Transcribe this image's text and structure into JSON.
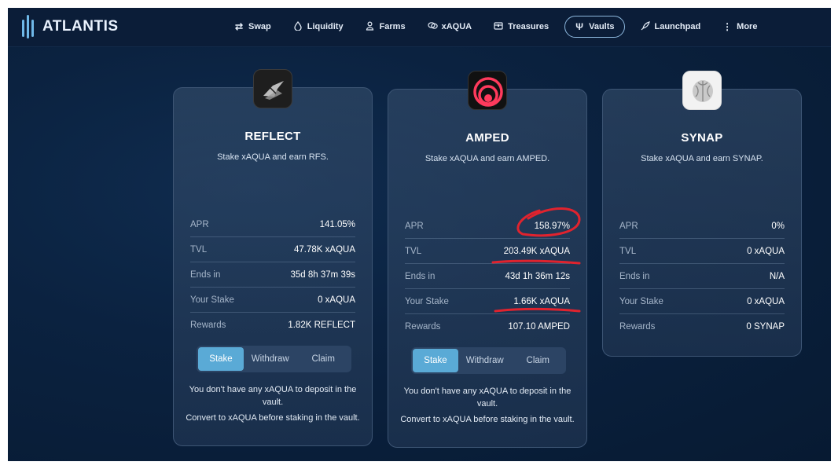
{
  "brand": {
    "name": "ATLANTIS"
  },
  "nav": {
    "items": [
      {
        "label": "Swap",
        "icon": "swap-icon"
      },
      {
        "label": "Liquidity",
        "icon": "droplet-icon"
      },
      {
        "label": "Farms",
        "icon": "farm-icon"
      },
      {
        "label": "xAQUA",
        "icon": "coins-icon"
      },
      {
        "label": "Treasures",
        "icon": "treasure-icon"
      },
      {
        "label": "Vaults",
        "icon": "trident-icon",
        "active": true
      },
      {
        "label": "Launchpad",
        "icon": "rocket-icon"
      },
      {
        "label": "More",
        "icon": "more-icon"
      }
    ]
  },
  "vaults": [
    {
      "title": "REFLECT",
      "description": "Stake xAQUA and earn RFS.",
      "token_icon": "reflect-token-icon",
      "stats": {
        "apr": {
          "label": "APR",
          "value": "141.05%"
        },
        "tvl": {
          "label": "TVL",
          "value": "47.78K xAQUA"
        },
        "ends": {
          "label": "Ends in",
          "value": "35d 8h 37m 39s"
        },
        "stake": {
          "label": "Your Stake",
          "value": "0 xAQUA"
        },
        "rewards": {
          "label": "Rewards",
          "value": "1.82K REFLECT"
        }
      },
      "tabs": [
        "Stake",
        "Withdraw",
        "Claim"
      ],
      "notice": [
        "You don't have any xAQUA to deposit in the vault.",
        "Convert to xAQUA before staking in the vault."
      ]
    },
    {
      "title": "AMPED",
      "description": "Stake xAQUA and earn AMPED.",
      "token_icon": "amped-token-icon",
      "stats": {
        "apr": {
          "label": "APR",
          "value": "158.97%"
        },
        "tvl": {
          "label": "TVL",
          "value": "203.49K xAQUA"
        },
        "ends": {
          "label": "Ends in",
          "value": "43d 1h 36m 12s"
        },
        "stake": {
          "label": "Your Stake",
          "value": "1.66K xAQUA"
        },
        "rewards": {
          "label": "Rewards",
          "value": "107.10 AMPED"
        }
      },
      "tabs": [
        "Stake",
        "Withdraw",
        "Claim"
      ],
      "notice": [
        "You don't have any xAQUA to deposit in the vault.",
        "Convert to xAQUA before staking in the vault."
      ]
    },
    {
      "title": "SYNAP",
      "description": "Stake xAQUA and earn SYNAP.",
      "token_icon": "synap-token-icon",
      "stats": {
        "apr": {
          "label": "APR",
          "value": "0%"
        },
        "tvl": {
          "label": "TVL",
          "value": "0 xAQUA"
        },
        "ends": {
          "label": "Ends in",
          "value": "N/A"
        },
        "stake": {
          "label": "Your Stake",
          "value": "0 xAQUA"
        },
        "rewards": {
          "label": "Rewards",
          "value": "0 SYNAP"
        }
      }
    }
  ],
  "colors": {
    "accent": "#5aaad6",
    "annotation": "#e0232e",
    "background": "#0b2240"
  }
}
